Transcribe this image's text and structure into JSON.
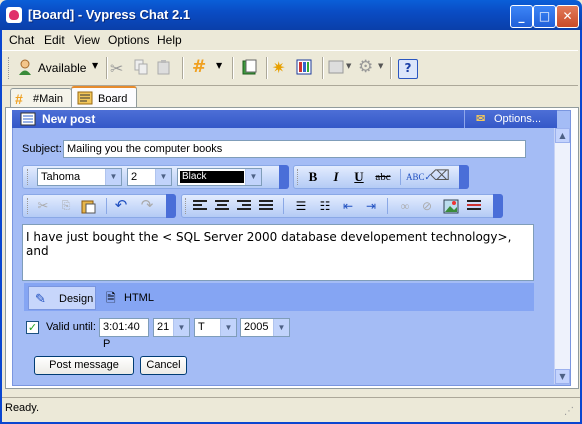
{
  "window": {
    "title": "[Board] - Vypress Chat 2.1",
    "controls": [
      "_",
      "□",
      "✕"
    ]
  },
  "menu": [
    "Chat",
    "Edit",
    "View",
    "Options",
    "Help"
  ],
  "toolbar": {
    "status_label": "Available"
  },
  "tabs": [
    {
      "label": "#Main"
    },
    {
      "label": "Board"
    }
  ],
  "panel": {
    "title": "New post",
    "options_label": "Options..."
  },
  "subject": {
    "label": "Subject:",
    "value": "Mailing you the computer books"
  },
  "format": {
    "font": "Tahoma",
    "size": "2",
    "color": "Black",
    "color_hex": "#000000"
  },
  "editor": {
    "text": "I have just bought the < SQL Server 2000 database developement technology>, and"
  },
  "view_tabs": [
    {
      "label": "Design"
    },
    {
      "label": "HTML"
    }
  ],
  "valid": {
    "label": "Valid until:",
    "checked": true,
    "time": "3:01:40 P",
    "day": "21",
    "month": "T",
    "year": "2005"
  },
  "buttons": {
    "post": "Post message",
    "cancel": "Cancel"
  },
  "status": {
    "text": "Ready."
  }
}
